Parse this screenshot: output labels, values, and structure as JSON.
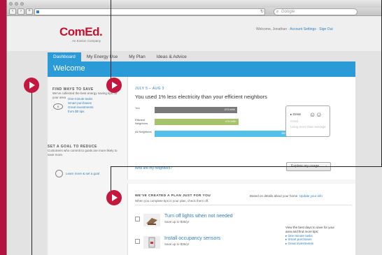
{
  "browser": {
    "url": "",
    "search_placeholder": "Google",
    "back": "‹",
    "forward": "›",
    "reload": "↻",
    "search_icon": "search-icon"
  },
  "header": {
    "logo": "ComEd.",
    "logo_sub": "An Exelon Company",
    "welcome_user": "Welcome, Jonathan",
    "account_link": "Account Settings",
    "signout_link": "Sign Out",
    "separator": "·"
  },
  "tabs": [
    {
      "label": "Dashboard",
      "active": true
    },
    {
      "label": "My Energy Use",
      "active": false
    },
    {
      "label": "My Plan",
      "active": false
    },
    {
      "label": "Ideas & Advice",
      "active": false
    }
  ],
  "banner": {
    "title": "Welcome"
  },
  "sidebar": {
    "find_heading": "FIND WAYS TO SAVE",
    "find_text": "We've collected the best energy saving tips for your area",
    "find_links": [
      "One-minute tasks",
      "Smart purchases",
      "Great investments"
    ],
    "find_more": "from $0 tips",
    "goal_heading": "SET A GOAL TO REDUCE",
    "goal_text": "Customers who commit to goals are more likely to save more.",
    "goal_link": "Learn more & set a goal"
  },
  "comparison": {
    "date_range": "JULY 5 – AUG 3",
    "headline": "You used 1% less electricity than your efficient neighbors",
    "unit": "kWh",
    "bars": [
      {
        "label": "You",
        "value": 473,
        "value_label": "473 kWh",
        "color": "#7a7a7a"
      },
      {
        "label": "Efficient Neighbors",
        "value": 478,
        "value_label": "478 kWh",
        "color": "#a8c26a"
      },
      {
        "label": "All Neighbors",
        "value": 801,
        "value_label": "801 kWh",
        "color": "#54bfe8"
      }
    ],
    "max_value": 820,
    "neighbors_link": "Who are my neighbors?",
    "legend": {
      "great": "Great",
      "good": "Good",
      "below": "Using more than average"
    },
    "explore_button": "Explore my usage",
    "explore_arrow": "›"
  },
  "plan": {
    "heading": "WE'VE CREATED A PLAN JUST FOR YOU",
    "subtext": "When you complete tips in your plan, check them off.",
    "based_on": "Based on details about your home.",
    "update_link": "Update your info",
    "tips": [
      {
        "title": "Turn off lights when not needed",
        "save": "Save up to $35/yr"
      },
      {
        "title": "Install occupancy sensors",
        "save": "Save up to $35/yr"
      }
    ],
    "best_days_text": "View the best days to save for your area and find more tips:",
    "best_days_links": [
      "One-minute tasks",
      "Smart purchases",
      "Great investments"
    ]
  },
  "colors": {
    "brand_red": "#c8102e",
    "accent_blue": "#2a9bd6",
    "play_red": "#c4173e"
  }
}
